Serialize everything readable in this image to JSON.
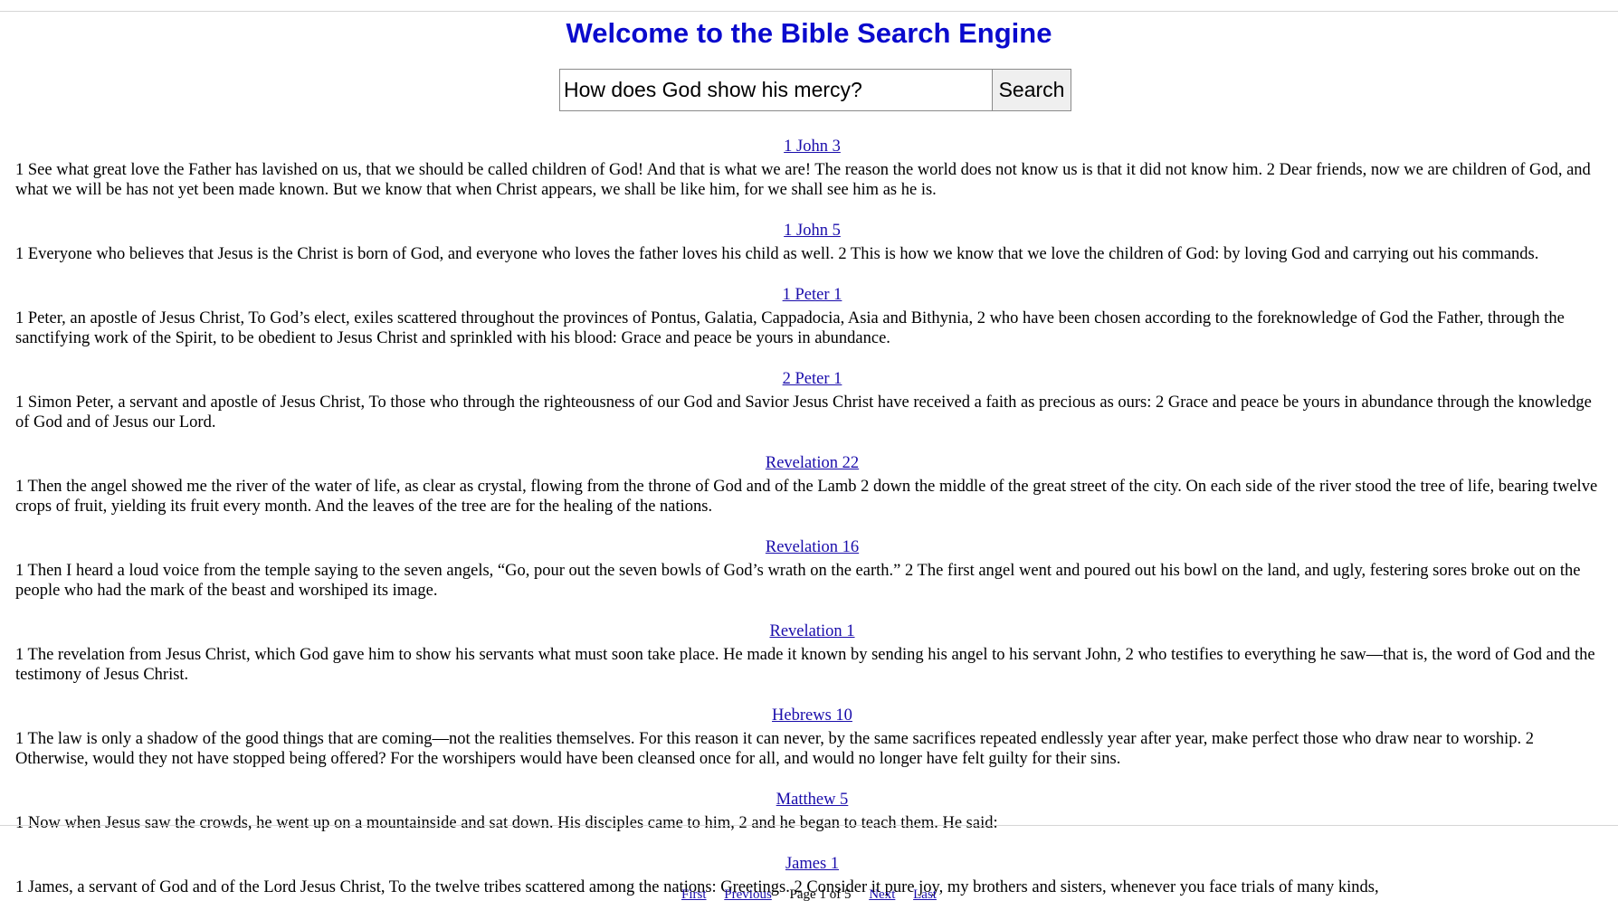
{
  "header": {
    "title": "Welcome to the Bible Search Engine",
    "title_color": "#0a0acd"
  },
  "search": {
    "query": "How does God show his mercy?",
    "button_label": "Search"
  },
  "results": [
    {
      "reference": "1 John 3",
      "text": "1 See what great love the Father has lavished on us, that we should be called children of God! And that is what we are! The reason the world does not know us is that it did not know him. 2 Dear friends, now we are children of God, and what we will be has not yet been made known. But we know that when Christ appears, we shall be like him, for we shall see him as he is."
    },
    {
      "reference": "1 John 5",
      "text": "1 Everyone who believes that Jesus is the Christ is born of God, and everyone who loves the father loves his child as well. 2 This is how we know that we love the children of God: by loving God and carrying out his commands."
    },
    {
      "reference": "1 Peter 1",
      "text": "1 Peter, an apostle of Jesus Christ, To God’s elect, exiles scattered throughout the provinces of Pontus, Galatia, Cappadocia, Asia and Bithynia, 2 who have been chosen according to the foreknowledge of God the Father, through the sanctifying work of the Spirit, to be obedient to Jesus Christ and sprinkled with his blood: Grace and peace be yours in abundance."
    },
    {
      "reference": "2 Peter 1",
      "text": "1 Simon Peter, a servant and apostle of Jesus Christ, To those who through the righteousness of our God and Savior Jesus Christ have received a faith as precious as ours: 2 Grace and peace be yours in abundance through the knowledge of God and of Jesus our Lord."
    },
    {
      "reference": "Revelation 22",
      "text": "1 Then the angel showed me the river of the water of life, as clear as crystal, flowing from the throne of God and of the Lamb 2 down the middle of the great street of the city. On each side of the river stood the tree of life, bearing twelve crops of fruit, yielding its fruit every month. And the leaves of the tree are for the healing of the nations."
    },
    {
      "reference": "Revelation 16",
      "text": "1 Then I heard a loud voice from the temple saying to the seven angels, “Go, pour out the seven bowls of God’s wrath on the earth.” 2 The first angel went and poured out his bowl on the land, and ugly, festering sores broke out on the people who had the mark of the beast and worshiped its image."
    },
    {
      "reference": "Revelation 1",
      "text": "1 The revelation from Jesus Christ, which God gave him to show his servants what must soon take place. He made it known by sending his angel to his servant John, 2 who testifies to everything he saw—that is, the word of God and the testimony of Jesus Christ."
    },
    {
      "reference": "Hebrews 10",
      "text": "1 The law is only a shadow of the good things that are coming—not the realities themselves. For this reason it can never, by the same sacrifices repeated endlessly year after year, make perfect those who draw near to worship. 2 Otherwise, would they not have stopped being offered? For the worshipers would have been cleansed once for all, and would no longer have felt guilty for their sins."
    },
    {
      "reference": "Matthew 5",
      "text": "1 Now when Jesus saw the crowds, he went up on a mountainside and sat down. His disciples came to him, 2 and he began to teach them. He said:"
    },
    {
      "reference": "James 1",
      "text": "1 James, a servant of God and of the Lord Jesus Christ, To the twelve tribes scattered among the nations: Greetings. 2 Consider it pure joy, my brothers and sisters, whenever you face trials of many kinds,"
    }
  ],
  "pagination": {
    "first": "First",
    "previous": "Previous",
    "page_indicator": "Page 1 of 5",
    "next": "Next",
    "last": "Last"
  }
}
